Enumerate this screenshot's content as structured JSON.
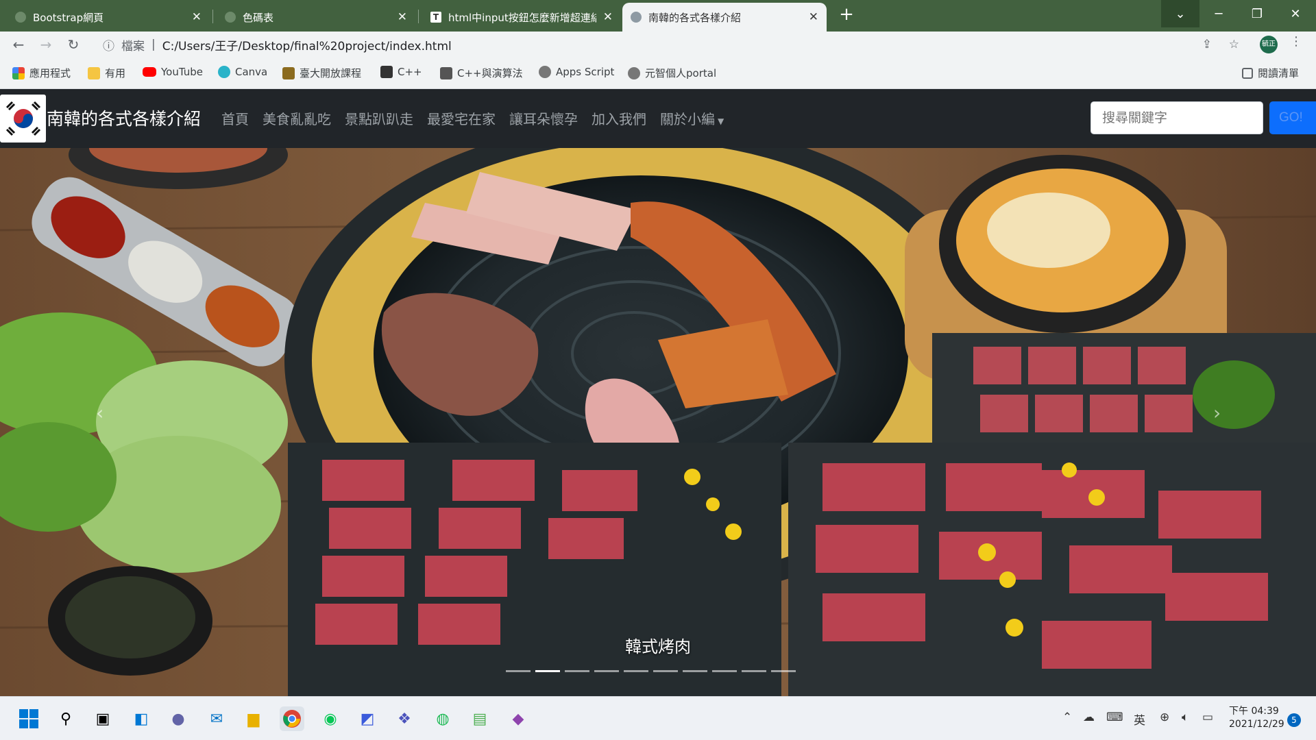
{
  "browser": {
    "tabs": [
      {
        "title": "Bootstrap網頁",
        "active": false
      },
      {
        "title": "色碼表",
        "active": false
      },
      {
        "title": "html中input按鈕怎麼新增超連結",
        "active": false
      },
      {
        "title": "南韓的各式各樣介紹",
        "active": true
      }
    ],
    "address": {
      "security_label": "檔案",
      "url": "C:/Users/王子/Desktop/final%20project/index.html"
    },
    "profile_label": "毓正",
    "bookmarks": [
      {
        "label": "應用程式",
        "icon": "apps-grid-icon"
      },
      {
        "label": "有用",
        "icon": "folder-icon"
      },
      {
        "label": "YouTube",
        "icon": "youtube-icon"
      },
      {
        "label": "Canva",
        "icon": "canva-icon"
      },
      {
        "label": "臺大開放課程",
        "icon": "ntu-ocw-icon"
      },
      {
        "label": "C++",
        "icon": "cpp-icon"
      },
      {
        "label": "C++與演算法",
        "icon": "book-icon"
      },
      {
        "label": "Apps Script",
        "icon": "globe-icon"
      },
      {
        "label": "元智個人portal",
        "icon": "globe-icon"
      }
    ],
    "reading_list": "閱讀清單"
  },
  "site": {
    "brand": "南韓的各式各樣介紹",
    "nav": [
      "首頁",
      "美食亂亂吃",
      "景點趴趴走",
      "最愛宅在家",
      "讓耳朵懷孕",
      "加入我們",
      "關於小編"
    ],
    "search_placeholder": "搜尋關鍵字",
    "search_button": "GO!",
    "carousel": {
      "caption": "韓式烤肉",
      "slide_count": 10,
      "active_index": 1
    }
  },
  "taskbar": {
    "ime": "英",
    "time": "下午 04:39",
    "date": "2021/12/29",
    "notification_count": "5"
  },
  "colors": {
    "tabstrip": "#42613f",
    "navbar": "#212529",
    "primary_button": "#0d6efd"
  }
}
